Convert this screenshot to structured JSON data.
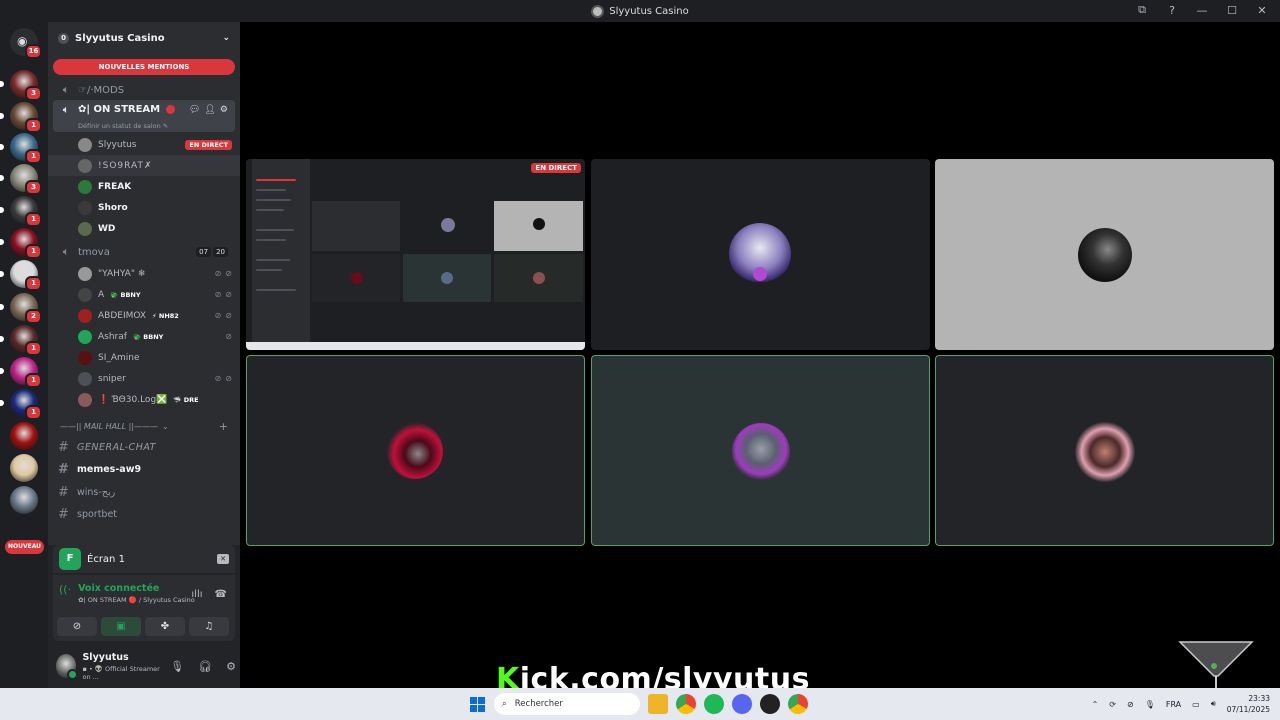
{
  "window": {
    "title": "Slyyutus Casino",
    "controls": {
      "minimize": "—",
      "maximize": "☐",
      "close": "✕"
    }
  },
  "servers": {
    "home_badge": "16",
    "items": [
      {
        "badge": "3",
        "color": "#7b2a2a"
      },
      {
        "badge": "1",
        "color": "#6a4a35"
      },
      {
        "badge": "1",
        "color": "#3c6b8a"
      },
      {
        "badge": "3",
        "color": "#8a8a7a"
      },
      {
        "badge": "1",
        "color": "#3a3a3a"
      },
      {
        "badge": "1",
        "color": "#8a1020"
      },
      {
        "badge": "1",
        "color": "#dcdcdc"
      },
      {
        "badge": "2",
        "color": "#7a6a55"
      },
      {
        "badge": "1",
        "color": "#5a2a2a"
      },
      {
        "badge": "1",
        "color": "#c0248a"
      },
      {
        "badge": "1",
        "color": "#1a2a7a"
      },
      {
        "badge": "",
        "color": "#a01010"
      },
      {
        "badge": "",
        "color": "#e0c8a0"
      },
      {
        "badge": "",
        "color": "#6a7a8a"
      }
    ],
    "new_label": "NOUVEAU"
  },
  "guild": {
    "name": "Slyyutus Casino",
    "mentions_label": "NOUVELLES MENTIONS"
  },
  "voice_channels": {
    "mods": "☞/·MODS",
    "on_stream": {
      "name": "✿| ON STREAM",
      "status": "Définir un statut de salon ✎"
    },
    "stream_users": [
      {
        "name": "Slyyutus",
        "live": "EN DIRECT",
        "color": "#888"
      },
      {
        "name": "!SO9RAT✗",
        "color": "#666"
      },
      {
        "name": "FREAK",
        "color": "#2a7a3a"
      },
      {
        "name": "Shoro",
        "color": "#3a3a3a"
      },
      {
        "name": "WD",
        "color": "#5a6a4a"
      }
    ],
    "tmova": {
      "name": "tmova",
      "count_a": "07",
      "count_b": "20"
    },
    "tmova_users": [
      {
        "name": "\"YAHYA\" ❄",
        "tag": "",
        "color": "#999"
      },
      {
        "name": "A",
        "tag": "🐲 BBNY",
        "color": "#444"
      },
      {
        "name": "ABDEIMOX",
        "tag": "⚡ NH82",
        "color": "#a02020"
      },
      {
        "name": "Ashraf",
        "tag": "🐲 BBNY",
        "color": "#23a559"
      },
      {
        "name": "SI_Amine",
        "tag": "",
        "color": "#5a1010"
      },
      {
        "name": "sniper",
        "tag": "",
        "color": "#4e5058"
      },
      {
        "name": "❗ ƁΘ30.Log❎",
        "tag": "🦈 DRE",
        "color": "#8a5a5a"
      }
    ]
  },
  "text_channels": {
    "category": "——|| MAIL HALL ||———",
    "items": [
      {
        "name": "GENERAL-CHAT"
      },
      {
        "name": "memes-aw9"
      },
      {
        "name": "wins-ربح"
      },
      {
        "name": "sportbet"
      }
    ]
  },
  "screen_share": {
    "label": "Écran 1",
    "icon": "F"
  },
  "voice": {
    "status": "Voix connectée",
    "channel": "✿| ON STREAM 🔴 / Slyyutus Casino"
  },
  "me": {
    "name": "Slyyutus",
    "status": "▪ • 👽 Official Streamer on ..."
  },
  "stage": {
    "live_label": "EN DIRECT"
  },
  "overlay": {
    "k": "K",
    "text": "ick.com/slyyutus"
  },
  "taskbar": {
    "search_placeholder": "Rechercher",
    "lang": "FRA",
    "time": "23:33",
    "date": "07/11/2025"
  }
}
